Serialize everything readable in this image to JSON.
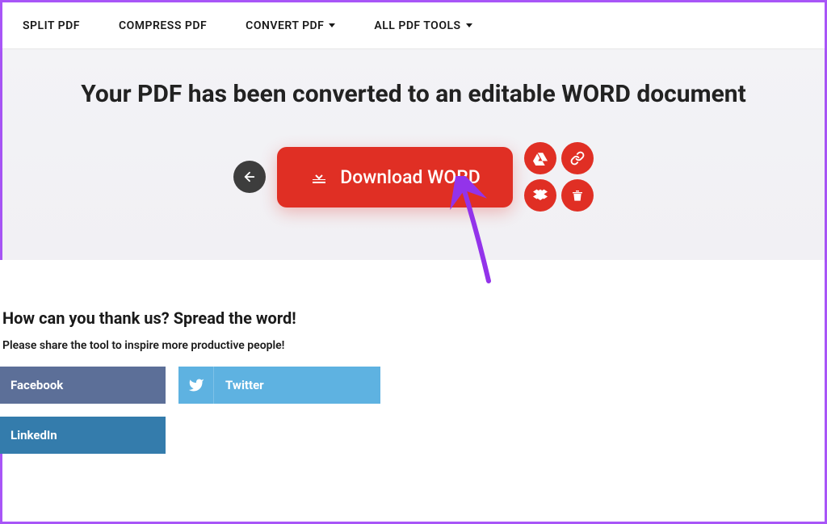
{
  "nav": {
    "split": "SPLIT PDF",
    "compress": "COMPRESS PDF",
    "convert": "CONVERT PDF",
    "all": "ALL PDF TOOLS"
  },
  "hero": {
    "title": "Your PDF has been converted to an editable WORD document",
    "download_label": "Download WORD"
  },
  "share": {
    "title": "How can you thank us? Spread the word!",
    "subtitle": "Please share the tool to inspire more productive people!",
    "facebook": "Facebook",
    "twitter": "Twitter",
    "linkedin": "LinkedIn"
  }
}
